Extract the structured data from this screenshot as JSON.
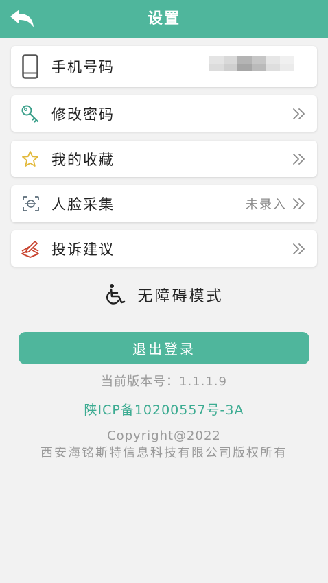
{
  "header": {
    "title": "设置",
    "back_icon": "back-arrow-icon"
  },
  "menu": {
    "phone": {
      "label": "手机号码",
      "icon": "phone-icon"
    },
    "password": {
      "label": "修改密码",
      "icon": "key-icon"
    },
    "favorites": {
      "label": "我的收藏",
      "icon": "star-icon"
    },
    "face": {
      "label": "人脸采集",
      "icon": "face-scan-icon",
      "status": "未录入"
    },
    "complaint": {
      "label": "投诉建议",
      "icon": "complaint-icon"
    }
  },
  "accessibility": {
    "label": "无障碍模式",
    "icon": "wheelchair-icon"
  },
  "logout": {
    "label": "退出登录"
  },
  "footer": {
    "version": "当前版本号：1.1.1.9",
    "icp": "陕ICP备10200557号-3A",
    "copyright": "Copyright@2022",
    "company": "西安海铭斯特信息科技有限公司版权所有"
  },
  "colors": {
    "primary": "#4fb69c",
    "link": "#3bab91",
    "muted": "#9a9a9a",
    "key_icon": "#3a9f8a",
    "star_icon": "#e2b93b",
    "complaint_icon": "#c8432f"
  }
}
